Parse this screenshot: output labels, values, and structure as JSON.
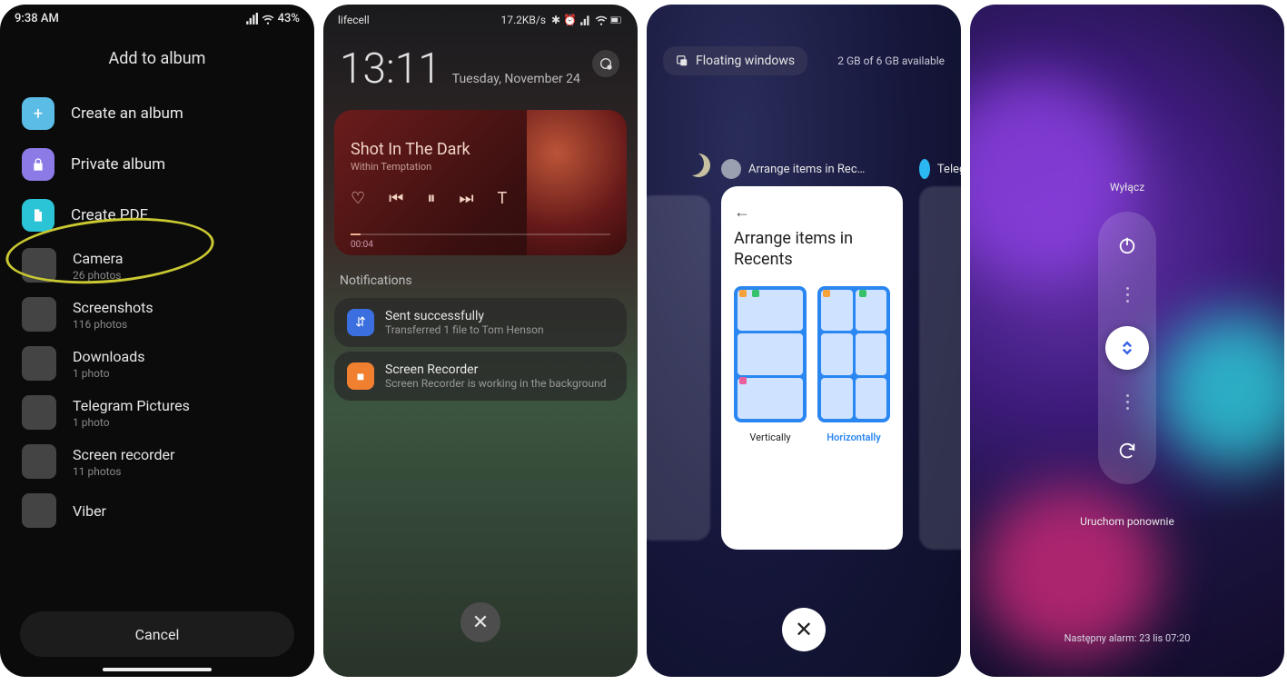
{
  "panel1": {
    "status": {
      "time": "9:38 AM",
      "battery": "43%"
    },
    "title": "Add to album",
    "actions": {
      "create_album": "Create an album",
      "private_album": "Private album",
      "create_pdf": "Create PDF"
    },
    "albums": [
      {
        "name": "Camera",
        "count": "26 photos"
      },
      {
        "name": "Screenshots",
        "count": "116 photos"
      },
      {
        "name": "Downloads",
        "count": "1 photo"
      },
      {
        "name": "Telegram Pictures",
        "count": "1 photo"
      },
      {
        "name": "Screen recorder",
        "count": "11 photos"
      },
      {
        "name": "Viber",
        "count": ""
      }
    ],
    "cancel": "Cancel"
  },
  "panel2": {
    "status": {
      "carrier": "lifecell",
      "speed": "17.2KB/s"
    },
    "clock": "13:11",
    "date": "Tuesday, November 24",
    "music": {
      "track": "Shot In The Dark",
      "artist": "Within Temptation",
      "timestamp": "00:04"
    },
    "section": "Notifications",
    "notifs": [
      {
        "title": "Sent successfully",
        "text": "Transferred 1 file to Tom Henson"
      },
      {
        "title": "Screen Recorder",
        "text": "Screen Recorder is working in the background"
      }
    ]
  },
  "panel3": {
    "floating": "Floating windows",
    "memory": "2 GB of 6 GB available",
    "apps": [
      {
        "label": "Arrange items in Rec…"
      },
      {
        "label": "Teleg…"
      }
    ],
    "card": {
      "title": "Arrange items in Recents",
      "opt_v": "Vertically",
      "opt_h": "Horizontally"
    }
  },
  "panel4": {
    "power_off": "Wyłącz",
    "reboot": "Uruchom ponownie",
    "alarm": "Następny alarm: 23 lis 07:20"
  }
}
